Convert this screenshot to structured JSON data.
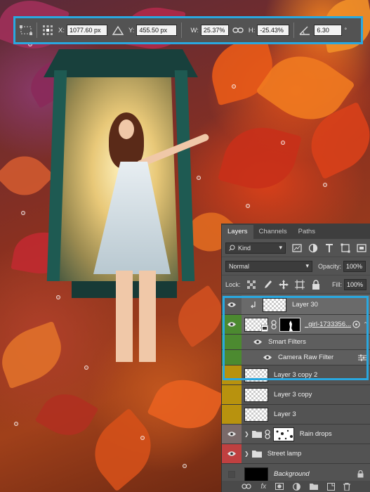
{
  "options_bar": {
    "x_label": "X:",
    "x_value": "1077.60 px",
    "y_label": "Y:",
    "y_value": "455.50 px",
    "w_label": "W:",
    "w_value": "25.37%",
    "h_label": "H:",
    "h_value": "-25.43%",
    "angle_value": "6.30",
    "angle_unit": "°"
  },
  "panel": {
    "tabs": [
      "Layers",
      "Channels",
      "Paths"
    ],
    "filter_kind": "Kind",
    "blend_mode": "Normal",
    "opacity_label": "Opacity:",
    "opacity_value": "100%",
    "lock_label": "Lock:",
    "fill_label": "Fill:",
    "fill_value": "100%"
  },
  "layers": [
    {
      "name": "Layer 30",
      "color": "#555555",
      "selected": true
    },
    {
      "name": "_girl-1733356...",
      "color": "#4c8a30",
      "selected": true
    },
    {
      "name": "Smart Filters",
      "color": "#4c8a30",
      "sub": true
    },
    {
      "name": "Camera Raw Filter",
      "color": "#4c8a30",
      "sub": true
    },
    {
      "name": "Layer 3 copy 2",
      "color": "#b8920e"
    },
    {
      "name": "Layer 3 copy",
      "color": "#b8920e"
    },
    {
      "name": "Layer 3",
      "color": "#b8920e"
    },
    {
      "name": "Rain drops",
      "color": "#7a6a6a"
    },
    {
      "name": "Street lamp",
      "color": "#c04040"
    },
    {
      "name": "Background",
      "color": "#555555"
    }
  ],
  "bottom_bar": {
    "fx_label": "fx"
  },
  "colors": {
    "accent_highlight": "#29a8e0",
    "panel_bg": "#535353"
  }
}
